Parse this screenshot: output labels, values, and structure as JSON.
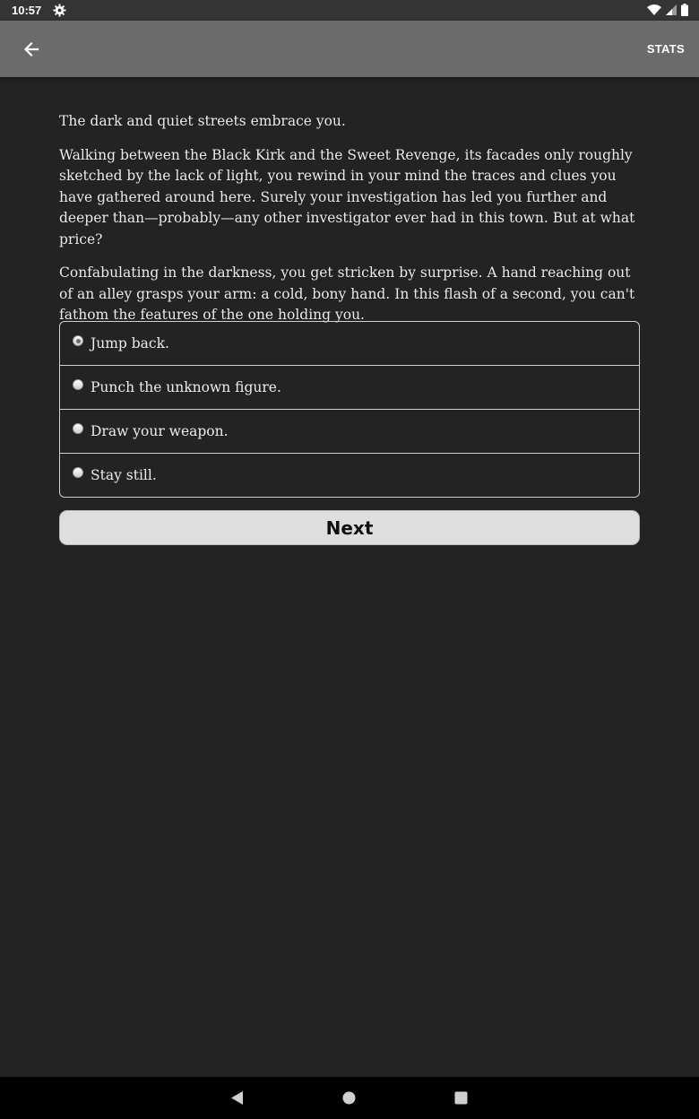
{
  "status_bar": {
    "time": "10:57",
    "icons": [
      "gear-icon",
      "wifi-icon",
      "signal-icon",
      "battery-icon"
    ]
  },
  "app_bar": {
    "back_icon": "arrow-left-icon",
    "stats_label": "STATS",
    "background": "#6b6b6b"
  },
  "story": {
    "paragraphs": [
      "The dark and quiet streets embrace you.",
      "Walking between the Black Kirk and the Sweet Revenge, its facades only roughly sketched by the lack of light, you rewind in your mind the traces and clues you have gathered around here. Surely your investigation has led you further and deeper than—probably—any other investigator ever had in this town. But at what price?",
      "Confabulating in the darkness, you get stricken by surprise. A hand reaching out of an alley grasps your arm: a cold, bony hand. In this flash of a second, you can't fathom the features of the one holding you."
    ]
  },
  "choices": [
    {
      "label": "Jump back.",
      "selected": true
    },
    {
      "label": "Punch the unknown figure.",
      "selected": false
    },
    {
      "label": "Draw your weapon.",
      "selected": false
    },
    {
      "label": "Stay still.",
      "selected": false
    }
  ],
  "next_label": "Next",
  "nav_bar": {
    "icons": [
      "back-triangle-icon",
      "home-circle-icon",
      "recents-square-icon"
    ]
  }
}
